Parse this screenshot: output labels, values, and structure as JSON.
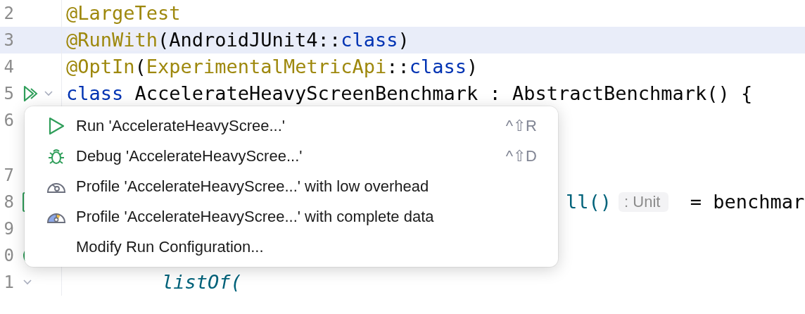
{
  "editor": {
    "lines": [
      {
        "number": "2",
        "current": false,
        "kind": "full",
        "tokens": [
          {
            "text": "@LargeTest",
            "kind": "annotation"
          }
        ]
      },
      {
        "number": "3",
        "current": true,
        "kind": "full",
        "tokens": [
          {
            "text": "@RunWith",
            "kind": "annotation-hl"
          },
          {
            "text": "(AndroidJUnit4::",
            "kind": "plain"
          },
          {
            "text": "class",
            "kind": "keyword"
          },
          {
            "text": ")",
            "kind": "plain"
          }
        ]
      },
      {
        "number": "4",
        "current": false,
        "kind": "full",
        "tokens": [
          {
            "text": "@OptIn",
            "kind": "annotation"
          },
          {
            "text": "(",
            "kind": "plain"
          },
          {
            "text": "ExperimentalMetricApi",
            "kind": "annotation"
          },
          {
            "text": "::",
            "kind": "plain"
          },
          {
            "text": "class",
            "kind": "keyword"
          },
          {
            "text": ")",
            "kind": "plain"
          }
        ]
      },
      {
        "number": "5",
        "current": false,
        "kind": "full",
        "gutter": [
          {
            "kind": "run"
          },
          {
            "kind": "fold"
          }
        ],
        "tokens": [
          {
            "text": "class",
            "kind": "keyword"
          },
          {
            "text": " AccelerateHeavyScreenBenchmark : AbstractBenchmark() {",
            "kind": "plain"
          }
        ]
      },
      {
        "number": "6",
        "current": false,
        "kind": "full"
      },
      {
        "number": "7",
        "current": false,
        "kind": "spaced"
      },
      {
        "number": "8",
        "current": false,
        "kind": "partial",
        "gutter": [
          {
            "kind": "test"
          }
        ],
        "tokens": [
          {
            "text": "ll()",
            "kind": "call"
          },
          {
            "text": ": Unit",
            "kind": "hint"
          },
          {
            "text": " = benchmar",
            "kind": "plain"
          }
        ]
      },
      {
        "number": "9",
        "current": false,
        "kind": "full"
      },
      {
        "number": "0",
        "current": false,
        "kind": "full",
        "gutter": [
          {
            "kind": "status"
          }
        ]
      },
      {
        "number": "1",
        "current": false,
        "kind": "indented",
        "gutter": [
          {
            "kind": "fold"
          }
        ],
        "tokens": [
          {
            "text": "listOf(",
            "kind": "italic"
          }
        ]
      }
    ]
  },
  "menu": {
    "items": [
      {
        "kind": "run",
        "label": "Run 'AccelerateHeavyScree...'",
        "shortcut": "^⇧R"
      },
      {
        "kind": "debug",
        "label": "Debug 'AccelerateHeavyScree...'",
        "shortcut": "^⇧D"
      },
      {
        "kind": "profile-low",
        "label": "Profile 'AccelerateHeavyScree...' with low overhead"
      },
      {
        "kind": "profile-full",
        "label": "Profile 'AccelerateHeavyScree...' with complete data"
      },
      {
        "kind": "plain",
        "label": "Modify Run Configuration..."
      }
    ]
  }
}
